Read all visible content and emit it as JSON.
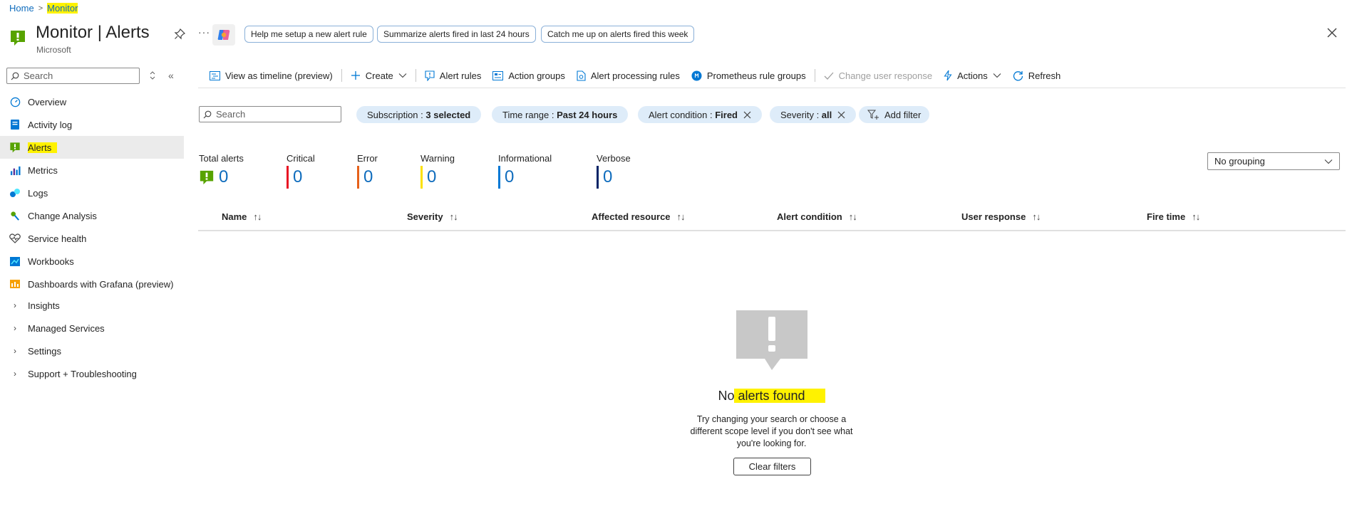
{
  "breadcrumb": {
    "home": "Home",
    "separator": ">",
    "current": "Monitor"
  },
  "header": {
    "title": "Monitor | Alerts",
    "subtitle": "Microsoft",
    "prompts": [
      "Help me setup a new alert rule",
      "Summarize alerts fired in last 24 hours",
      "Catch me up on alerts fired this week"
    ],
    "more": "···"
  },
  "sidebar": {
    "search_placeholder": "Search",
    "items": [
      {
        "label": "Overview",
        "icon": "overview-icon"
      },
      {
        "label": "Activity log",
        "icon": "activity-log-icon"
      },
      {
        "label": "Alerts",
        "icon": "alerts-icon"
      },
      {
        "label": "Metrics",
        "icon": "metrics-icon"
      },
      {
        "label": "Logs",
        "icon": "logs-icon"
      },
      {
        "label": "Change Analysis",
        "icon": "change-analysis-icon"
      },
      {
        "label": "Service health",
        "icon": "heart-icon"
      },
      {
        "label": "Workbooks",
        "icon": "workbooks-icon"
      },
      {
        "label": "Dashboards with Grafana (preview)",
        "icon": "grafana-icon"
      },
      {
        "label": "Insights",
        "icon": "chevron-right-icon"
      },
      {
        "label": "Managed Services",
        "icon": "chevron-right-icon"
      },
      {
        "label": "Settings",
        "icon": "chevron-right-icon"
      },
      {
        "label": "Support + Troubleshooting",
        "icon": "chevron-right-icon"
      }
    ]
  },
  "toolbar": {
    "timeline": "View as timeline (preview)",
    "create": "Create",
    "alert_rules": "Alert rules",
    "action_groups": "Action groups",
    "processing_rules": "Alert processing rules",
    "prometheus": "Prometheus rule groups",
    "change_response": "Change user response",
    "actions": "Actions",
    "refresh": "Refresh"
  },
  "filters": {
    "search_placeholder": "Search",
    "subscription_label": "Subscription : ",
    "subscription_value": "3 selected",
    "time_label": "Time range : ",
    "time_value": "Past 24 hours",
    "condition_label": "Alert condition : ",
    "condition_value": "Fired",
    "severity_label": "Severity : ",
    "severity_value": "all",
    "add_filter": "Add filter"
  },
  "summary": [
    {
      "label": "Total alerts",
      "value": "0",
      "color": "#57a300"
    },
    {
      "label": "Critical",
      "value": "0",
      "color": "#e81123"
    },
    {
      "label": "Error",
      "value": "0",
      "color": "#e6611a"
    },
    {
      "label": "Warning",
      "value": "0",
      "color": "#fce100"
    },
    {
      "label": "Informational",
      "value": "0",
      "color": "#0078d4"
    },
    {
      "label": "Verbose",
      "value": "0",
      "color": "#002366"
    }
  ],
  "grouping": {
    "value": "No grouping"
  },
  "table": {
    "columns": [
      "Name",
      "Severity",
      "Affected resource",
      "Alert condition",
      "User response",
      "Fire time"
    ],
    "sort_glyph": "↑↓"
  },
  "empty": {
    "title_prefix": "No",
    "title_highlight": " alerts found",
    "description": "Try changing your search or choose a different scope level if you don't see what you're looking for.",
    "clear_button": "Clear filters"
  }
}
